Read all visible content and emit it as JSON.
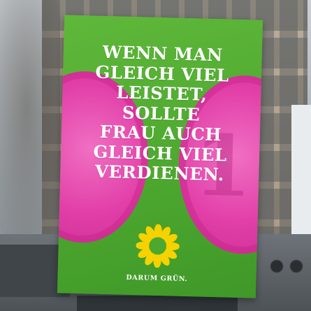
{
  "poster": {
    "headline_lines": [
      "WENN MAN",
      "GLEICH VIEL",
      "LEISTET,",
      "SOLLTE",
      "FRAU AUCH",
      "GLEICH VIEL",
      "VERDIENEN."
    ],
    "slogan": "DARUM GRÜN.",
    "colors": {
      "poster_green": "#4da82f",
      "coin_pink": "#e23fa8",
      "sunflower_yellow": "#f5d200",
      "text": "#ffffff"
    },
    "icons": [
      "sunflower-icon"
    ]
  }
}
